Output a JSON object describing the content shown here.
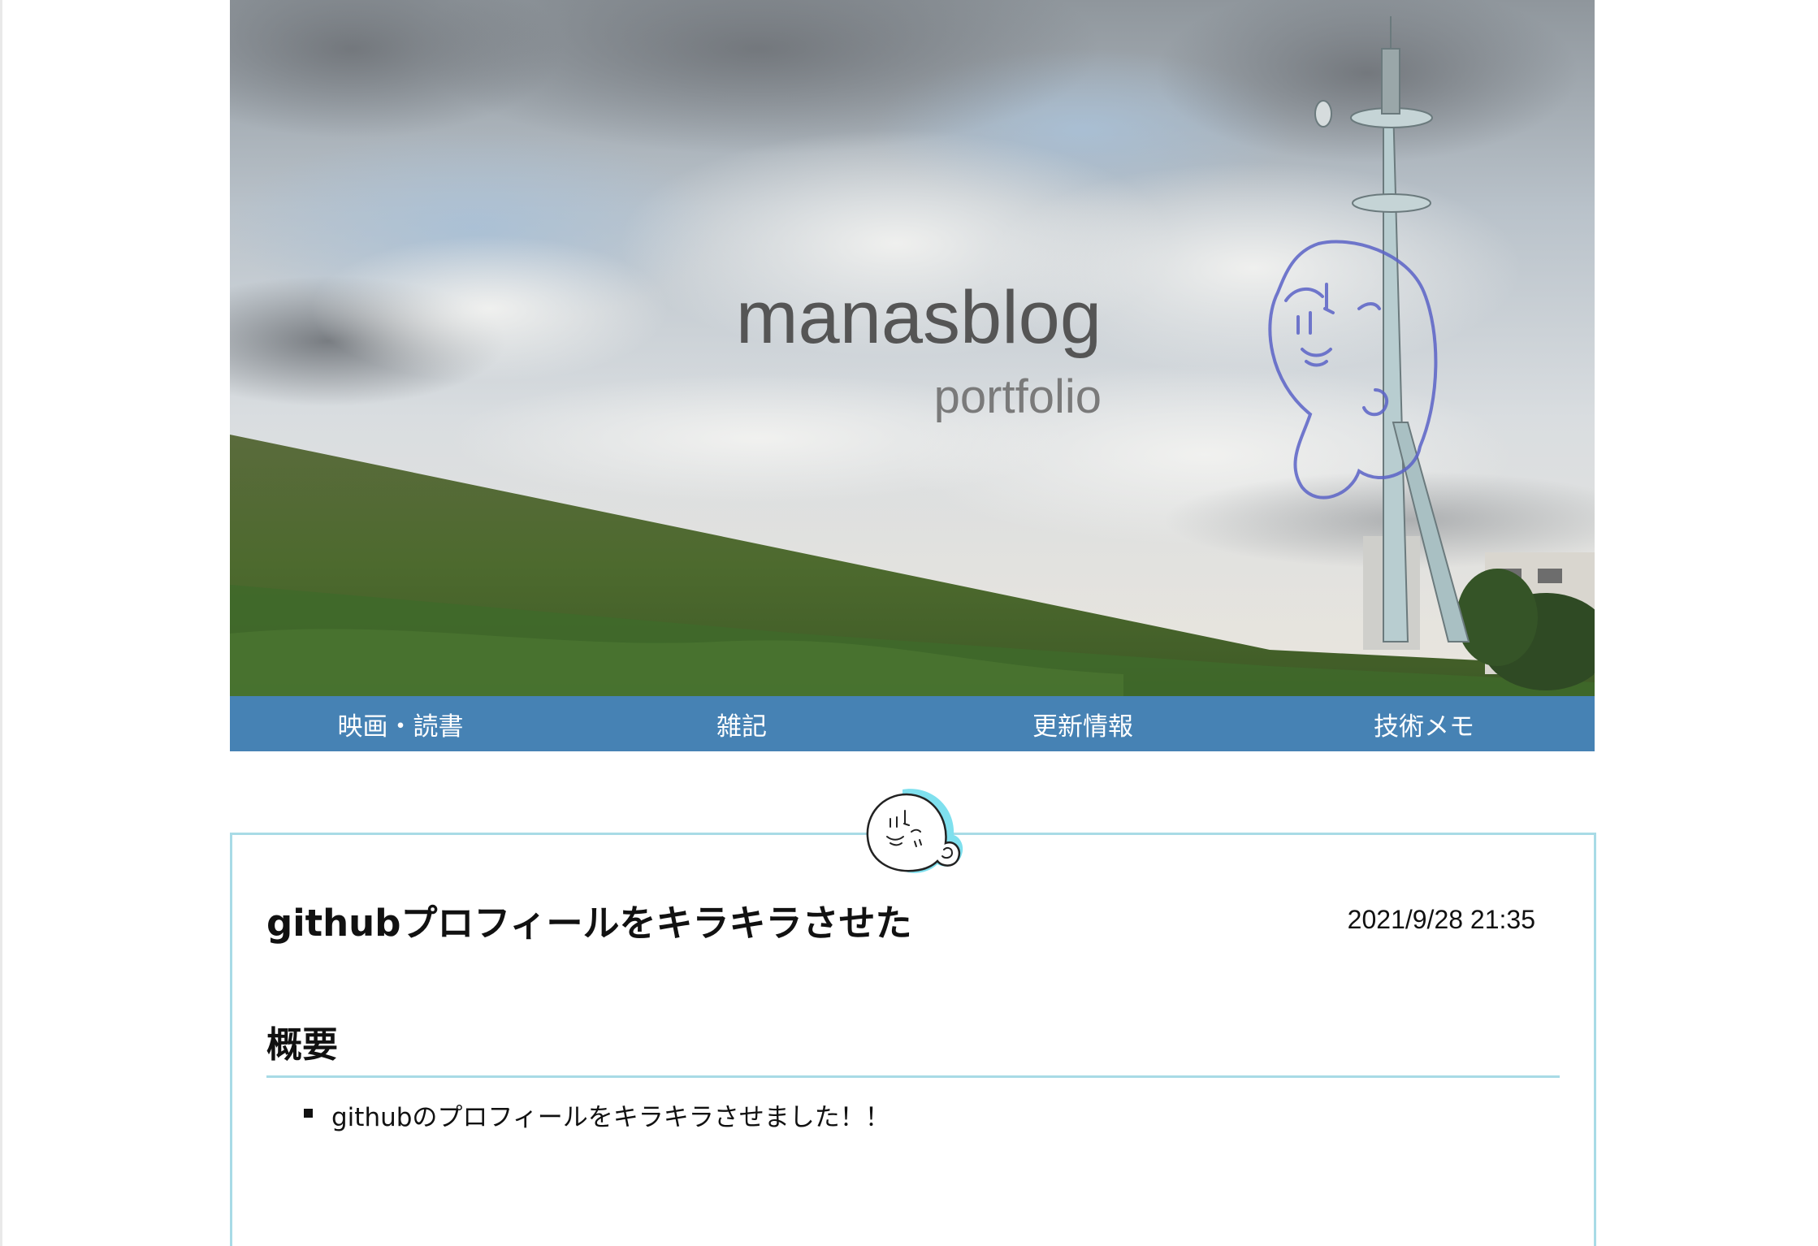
{
  "site": {
    "title": "manasblog",
    "subtitle": "portfolio"
  },
  "nav": {
    "items": [
      {
        "label": "映画・読書"
      },
      {
        "label": "雑記"
      },
      {
        "label": "更新情報"
      },
      {
        "label": "技術メモ"
      }
    ]
  },
  "article": {
    "title": "githubプロフィールをキラキラさせた",
    "date": "2021/9/28 21:35",
    "sections": [
      {
        "heading": "概要",
        "bullets": [
          "githubのプロフィールをキラキラさせました！！"
        ]
      }
    ]
  },
  "icons": {
    "header_image": "sky-riverbank-tower-photo",
    "mascot": "seal-mascot-icon",
    "badge": "seal-badge-icon"
  },
  "colors": {
    "nav_background": "#4682b4",
    "article_border": "#a8dbe6",
    "badge_accent": "#7fe0ee"
  }
}
